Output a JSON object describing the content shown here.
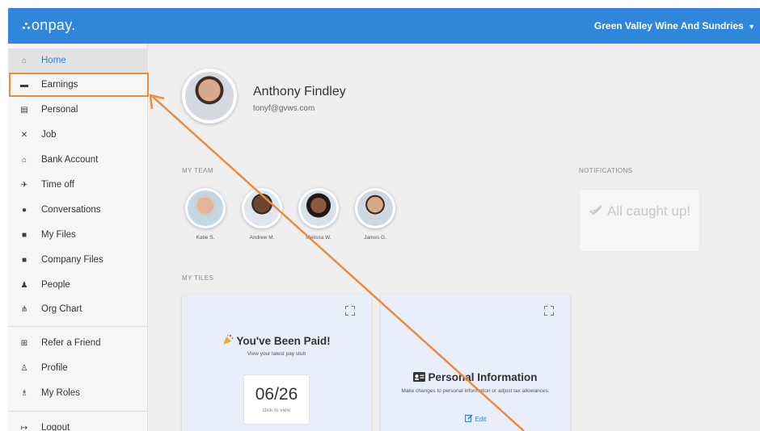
{
  "header": {
    "logo": "onpay.",
    "company": "Green Valley Wine And Sundries",
    "caret": "▼"
  },
  "sidebar": {
    "items": [
      {
        "label": "Home",
        "icon": "home-icon",
        "glyph": "⌂"
      },
      {
        "label": "Earnings",
        "icon": "money-icon",
        "glyph": "▬"
      },
      {
        "label": "Personal",
        "icon": "id-card-icon",
        "glyph": "▤"
      },
      {
        "label": "Job",
        "icon": "tools-icon",
        "glyph": "✕"
      },
      {
        "label": "Bank Account",
        "icon": "bank-icon",
        "glyph": "⌂"
      },
      {
        "label": "Time off",
        "icon": "plane-icon",
        "glyph": "✈"
      },
      {
        "label": "Conversations",
        "icon": "comments-icon",
        "glyph": "●"
      },
      {
        "label": "My Files",
        "icon": "files-icon",
        "glyph": "■"
      },
      {
        "label": "Company Files",
        "icon": "folder-icon",
        "glyph": "■"
      },
      {
        "label": "People",
        "icon": "people-icon",
        "glyph": "♟"
      },
      {
        "label": "Org Chart",
        "icon": "org-chart-icon",
        "glyph": "⋔"
      },
      {
        "label": "Refer a Friend",
        "icon": "gift-icon",
        "glyph": "⊞"
      },
      {
        "label": "Profile",
        "icon": "user-icon",
        "glyph": "♙"
      },
      {
        "label": "My Roles",
        "icon": "users-icon",
        "glyph": "♗"
      },
      {
        "label": "Logout",
        "icon": "logout-icon",
        "glyph": "↦"
      }
    ]
  },
  "profile": {
    "name": "Anthony Findley",
    "email": "tonyf@gvws.com"
  },
  "team": {
    "label": "MY TEAM",
    "members": [
      {
        "name": "Katie S."
      },
      {
        "name": "Andrew M."
      },
      {
        "name": "Melissa W."
      },
      {
        "name": "James G."
      }
    ]
  },
  "notifications": {
    "label": "NOTIFICATIONS",
    "icon": "check-double-icon",
    "message": "All caught up!"
  },
  "tiles": {
    "label": "MY TILES",
    "paid": {
      "icon": "party-popper-icon",
      "title": "You've Been Paid!",
      "subtitle": "View your latest pay stub",
      "date": "06/26",
      "cta": "click to view"
    },
    "personal": {
      "icon": "id-card-icon",
      "title": "Personal Information",
      "subtitle": "Make changes to personal information or adjust tax allowances.",
      "edit": "Edit"
    }
  },
  "colors": {
    "primary": "#2f86db",
    "highlight": "#ef8a3a",
    "tile_bg": "#e9eefb"
  }
}
